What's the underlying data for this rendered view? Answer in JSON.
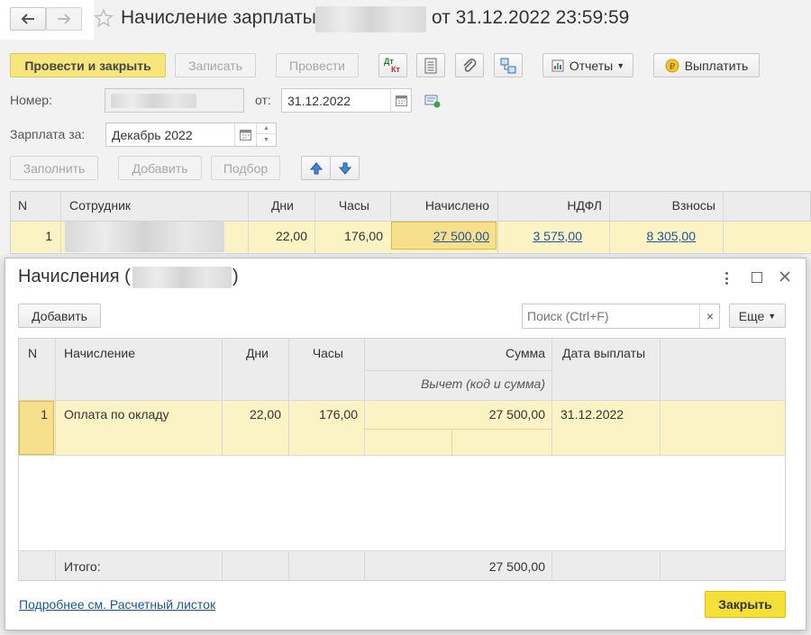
{
  "window": {
    "title_prefix": "Начисление зарплаты",
    "title_suffix": "от 31.12.2022 23:59:59"
  },
  "toolbar": {
    "post_close": "Провести и закрыть",
    "save": "Записать",
    "post": "Провести",
    "dtkt_top": "Дт",
    "dtkt_bottom": "Кт",
    "reports": "Отчеты",
    "pay": "Выплатить"
  },
  "form": {
    "number_label": "Номер:",
    "from_label": "от:",
    "date_value": "31.12.2022",
    "salary_for_label": "Зарплата за:",
    "period_value": "Декабрь 2022"
  },
  "actions": {
    "fill": "Заполнить",
    "add": "Добавить",
    "select": "Подбор"
  },
  "main_table": {
    "headers": {
      "n": "N",
      "employee": "Сотрудник",
      "days": "Дни",
      "hours": "Часы",
      "accrued": "Начислено",
      "ndfl": "НДФЛ",
      "contrib": "Взносы"
    },
    "row": {
      "n": "1",
      "days": "22,00",
      "hours": "176,00",
      "accrued": "27 500,00",
      "ndfl": "3 575,00",
      "contrib": "8 305,00"
    }
  },
  "dialog": {
    "title_prefix": "Начисления (",
    "title_suffix": ")",
    "add_button": "Добавить",
    "search_placeholder": "Поиск (Ctrl+F)",
    "clear": "×",
    "more": "Еще",
    "headers": {
      "n": "N",
      "accrual": "Начисление",
      "days": "Дни",
      "hours": "Часы",
      "sum": "Сумма",
      "deduction": "Вычет (код и сумма)",
      "pay_date": "Дата выплаты"
    },
    "row": {
      "n": "1",
      "accrual": "Оплата по окладу",
      "days": "22,00",
      "hours": "176,00",
      "sum": "27 500,00",
      "pay_date": "31.12.2022"
    },
    "total_label": "Итого:",
    "total_sum": "27 500,00",
    "link": "Подробнее см. Расчетный листок",
    "close_button": "Закрыть"
  },
  "colors": {
    "accent_yellow": "#f6e67c",
    "row_highlight": "#fbf3c4",
    "link": "#1a55a2",
    "close_button": "#f5e03a"
  }
}
